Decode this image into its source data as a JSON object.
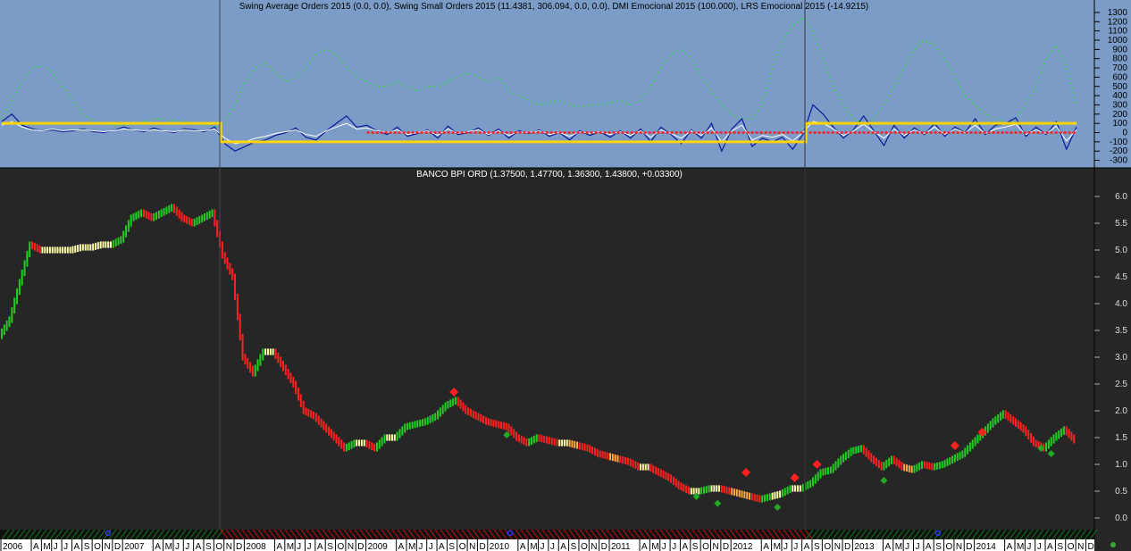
{
  "chart_data": [
    {
      "type": "line",
      "title": "Swing Average Orders 2015 (0.0, 0.0), Swing Small Orders 2015 (11.4381, 306.094, 0.0, 0.0), DMI Emocional 2015 (100.000), LRS Emocional 2015 (-14.9215)",
      "ylim": [
        -350,
        1400
      ],
      "yticks": [
        1300,
        1200,
        1100,
        1000,
        900,
        800,
        700,
        600,
        500,
        400,
        300,
        200,
        100,
        0,
        -100,
        -200,
        -300
      ],
      "x_unit": "month index from Jan 2006",
      "series": [
        {
          "name": "green-dotted",
          "color": "#33dd33",
          "values": [
            150,
            350,
            550,
            700,
            720,
            650,
            500,
            350,
            200,
            120,
            100,
            80,
            80,
            100,
            120,
            150,
            150,
            130,
            120,
            100,
            80,
            60,
            100,
            300,
            550,
            700,
            750,
            650,
            550,
            600,
            700,
            850,
            900,
            850,
            700,
            600,
            550,
            500,
            500,
            550,
            500,
            450,
            500,
            500,
            550,
            600,
            650,
            600,
            550,
            600,
            450,
            400,
            350,
            300,
            320,
            350,
            300,
            280,
            300,
            300,
            320,
            350,
            300,
            350,
            500,
            700,
            850,
            900,
            800,
            600,
            450,
            300,
            200,
            150,
            150,
            300,
            700,
            1000,
            1150,
            1250,
            1100,
            800,
            500,
            300,
            150,
            100,
            150,
            300,
            500,
            700,
            900,
            1000,
            950,
            800,
            600,
            400,
            300,
            200,
            150,
            100,
            150,
            300,
            500,
            800,
            950,
            700,
            300
          ]
        },
        {
          "name": "blue",
          "color": "#0a1a99",
          "values": [
            120,
            200,
            80,
            40,
            20,
            30,
            10,
            20,
            40,
            10,
            0,
            20,
            60,
            30,
            10,
            50,
            20,
            0,
            40,
            30,
            10,
            60,
            -120,
            -200,
            -150,
            -100,
            -80,
            -30,
            0,
            50,
            -50,
            -80,
            20,
            100,
            180,
            60,
            80,
            20,
            -20,
            60,
            -40,
            -10,
            30,
            -60,
            70,
            -20,
            0,
            50,
            -30,
            40,
            -60,
            20,
            -10,
            30,
            -40,
            0,
            -80,
            20,
            -30,
            10,
            -50,
            20,
            -60,
            40,
            -100,
            60,
            -20,
            -120,
            30,
            -60,
            100,
            -200,
            40,
            150,
            -150,
            -60,
            -100,
            -50,
            -180,
            -20,
            300,
            200,
            60,
            -60,
            30,
            180,
            20,
            -140,
            80,
            -60,
            50,
            -20,
            100,
            -40,
            60,
            0,
            150,
            -20,
            80,
            100,
            160,
            -40,
            60,
            -20,
            120,
            -180,
            60
          ]
        },
        {
          "name": "white",
          "color": "#ffffff",
          "values": [
            80,
            120,
            60,
            30,
            20,
            40,
            20,
            30,
            30,
            20,
            10,
            20,
            40,
            30,
            20,
            30,
            20,
            10,
            30,
            20,
            20,
            40,
            -60,
            -120,
            -100,
            -60,
            -40,
            -10,
            10,
            30,
            -20,
            -40,
            20,
            60,
            100,
            40,
            50,
            20,
            0,
            30,
            -20,
            0,
            20,
            -30,
            40,
            -10,
            10,
            30,
            -20,
            20,
            -30,
            10,
            0,
            20,
            -20,
            0,
            -40,
            10,
            -10,
            10,
            -20,
            10,
            -30,
            20,
            -50,
            30,
            -10,
            -60,
            20,
            -30,
            50,
            -100,
            20,
            80,
            -80,
            -30,
            -50,
            -20,
            -90,
            0,
            120,
            100,
            40,
            -30,
            20,
            90,
            10,
            -60,
            40,
            -30,
            30,
            -10,
            60,
            -20,
            40,
            0,
            80,
            -10,
            40,
            60,
            90,
            -20,
            30,
            -10,
            70,
            -90,
            30
          ]
        },
        {
          "name": "red",
          "color": "#ff1a1a",
          "start_month": 36,
          "value": 0
        },
        {
          "name": "yellow-step",
          "color": "#ffd400",
          "steps": [
            {
              "from_month": 0,
              "value": 100
            },
            {
              "from_month": 21.6,
              "value": -100
            },
            {
              "from_month": 79.3,
              "value": 100
            }
          ]
        }
      ]
    },
    {
      "type": "line",
      "title": "BANCO BPI ORD (1.37500, 1.47700, 1.36300, 1.43800, +0.03300)",
      "ylim": [
        -0.2,
        6.5
      ],
      "yticks": [
        "6.0",
        "5.5",
        "5.0",
        "4.5",
        "4.0",
        "3.5",
        "3.0",
        "2.5",
        "2.0",
        "1.5",
        "1.0",
        "0.5",
        "0.0"
      ],
      "x_unit": "month index from Jan 2006",
      "close": [
        3.4,
        3.7,
        4.4,
        5.1,
        5.0,
        5.0,
        5.0,
        5.0,
        5.05,
        5.05,
        5.1,
        5.1,
        5.2,
        5.6,
        5.7,
        5.6,
        5.7,
        5.8,
        5.6,
        5.5,
        5.6,
        5.7,
        4.9,
        4.5,
        3.0,
        2.7,
        3.1,
        3.1,
        2.8,
        2.5,
        2.0,
        1.9,
        1.7,
        1.5,
        1.3,
        1.4,
        1.4,
        1.3,
        1.5,
        1.5,
        1.7,
        1.75,
        1.8,
        1.9,
        2.1,
        2.2,
        2.0,
        1.9,
        1.8,
        1.75,
        1.7,
        1.5,
        1.4,
        1.5,
        1.45,
        1.4,
        1.4,
        1.35,
        1.3,
        1.2,
        1.15,
        1.1,
        1.05,
        0.95,
        0.95,
        0.85,
        0.75,
        0.6,
        0.5,
        0.5,
        0.55,
        0.55,
        0.5,
        0.45,
        0.4,
        0.35,
        0.4,
        0.45,
        0.55,
        0.55,
        0.65,
        0.85,
        0.9,
        1.1,
        1.25,
        1.3,
        1.1,
        0.95,
        1.1,
        0.95,
        0.9,
        1.0,
        0.95,
        1.0,
        1.1,
        1.2,
        1.4,
        1.6,
        1.8,
        1.95,
        1.8,
        1.65,
        1.4,
        1.3,
        1.5,
        1.65,
        1.45
      ],
      "sell_markers": [
        [
          44.6,
          2.35
        ],
        [
          73.4,
          0.85
        ],
        [
          78.2,
          0.75
        ],
        [
          80.4,
          1.0
        ],
        [
          94,
          1.35
        ],
        [
          96.7,
          1.6
        ]
      ],
      "buy_markers": [
        [
          49.8,
          1.55
        ],
        [
          68.5,
          0.4
        ],
        [
          70.6,
          0.27
        ],
        [
          76.5,
          0.2
        ],
        [
          87,
          0.7
        ],
        [
          102.5,
          1.3
        ],
        [
          103.5,
          1.2
        ]
      ],
      "regimes": [
        {
          "to_month": 21.6,
          "color": "#1a7a1a"
        },
        {
          "to_month": 79.3,
          "color": "#d01010"
        },
        {
          "to_month": 107.8,
          "color": "#1a7a1a"
        }
      ]
    }
  ],
  "xaxis": {
    "labels": [
      "2006",
      "A",
      "M",
      "J",
      "J",
      "A",
      "S",
      "O",
      "N",
      "D",
      "2007",
      "A",
      "M",
      "J",
      "J",
      "A",
      "S",
      "O",
      "N",
      "D",
      "2008",
      "A",
      "M",
      "J",
      "J",
      "A",
      "S",
      "O",
      "N",
      "D",
      "2009",
      "A",
      "M",
      "J",
      "J",
      "A",
      "S",
      "O",
      "N",
      "D",
      "2010",
      "A",
      "M",
      "J",
      "J",
      "A",
      "S",
      "O",
      "N",
      "D",
      "2011",
      "A",
      "M",
      "J",
      "J",
      "A",
      "S",
      "O",
      "N",
      "D",
      "2012",
      "A",
      "M",
      "J",
      "J",
      "A",
      "S",
      "O",
      "N",
      "D",
      "2013",
      "A",
      "M",
      "J",
      "J",
      "A",
      "S",
      "O",
      "N",
      "D",
      "2014",
      "A",
      "M",
      "J",
      "J",
      "A",
      "S",
      "O",
      "N",
      "D"
    ]
  }
}
